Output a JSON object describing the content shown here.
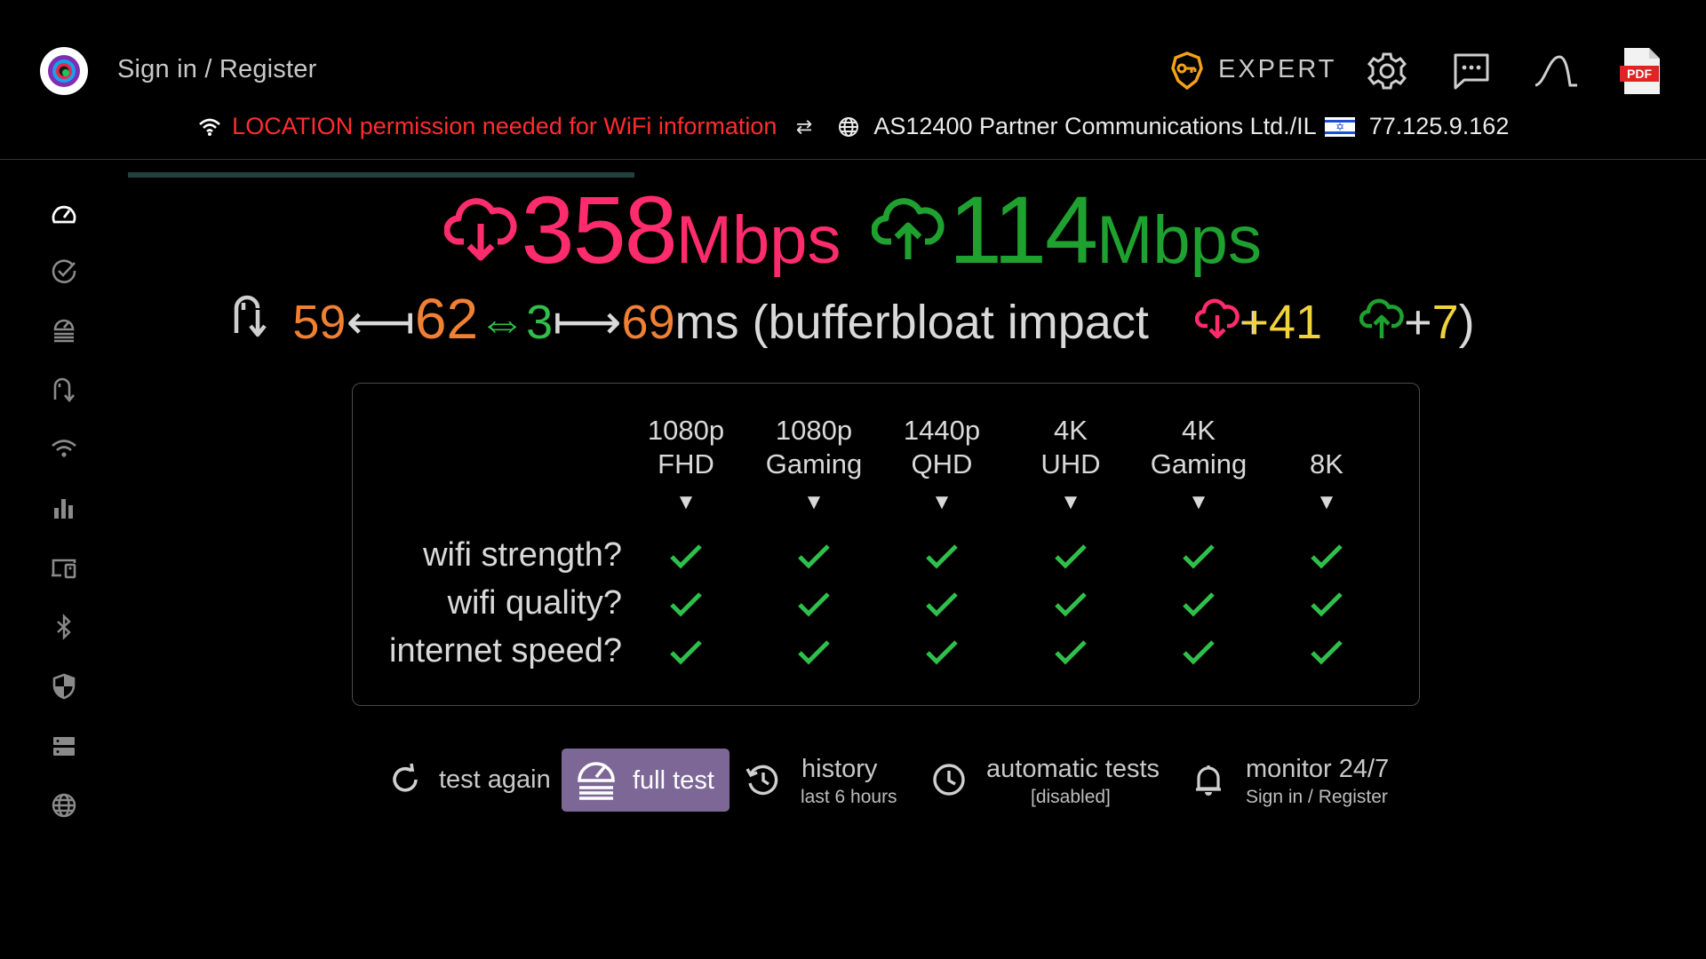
{
  "header": {
    "signin_label": "Sign in / Register",
    "expert_label": "EXPERT",
    "icons": [
      "logo-icon",
      "expert-key-icon",
      "settings-icon",
      "chat-icon",
      "graph-icon",
      "pdf-icon"
    ],
    "pdf_text": "PDF"
  },
  "infobar": {
    "location_warning": "LOCATION permission needed for WiFi information",
    "arrows": "⇄",
    "isp": "AS12400 Partner Communications Ltd./IL",
    "ip": "77.125.9.162"
  },
  "test_progress": 0.3,
  "sidebar": {
    "items": [
      "speedometer-icon",
      "check-circle-icon",
      "speedtest-list-icon",
      "latency-icon",
      "wifi-icon",
      "bar-chart-icon",
      "devices-icon",
      "bluetooth-icon",
      "shield-icon",
      "server-icon",
      "globe-icon"
    ],
    "active_index": 0
  },
  "speed": {
    "download_value": "358",
    "download_unit": "Mbps",
    "upload_value": "114",
    "upload_unit": "Mbps"
  },
  "latency": {
    "idle": "59",
    "arrow_left": "⟻",
    "loaded": "62",
    "double_arrow": "⇔",
    "jitter": "3",
    "arrow_right": "⟼",
    "max": "69",
    "suffix": "ms (bufferbloat impact",
    "dl_impact": "+41",
    "ul_plus": "+",
    "ul_impact": "7",
    "close": ")"
  },
  "quality_table": {
    "columns": [
      {
        "line1": "1080p",
        "line2": "FHD"
      },
      {
        "line1": "1080p",
        "line2": "Gaming"
      },
      {
        "line1": "1440p",
        "line2": "QHD"
      },
      {
        "line1": "4K",
        "line2": "UHD"
      },
      {
        "line1": "4K",
        "line2": "Gaming"
      },
      {
        "line1": "",
        "line2": "8K"
      }
    ],
    "arrow": "▼",
    "rows": [
      "wifi strength?",
      "wifi quality?",
      "internet speed?"
    ],
    "status": [
      [
        true,
        true,
        true,
        true,
        true,
        true
      ],
      [
        true,
        true,
        true,
        true,
        true,
        true
      ],
      [
        true,
        true,
        true,
        true,
        true,
        true
      ]
    ],
    "check_color": "#2fbf4a"
  },
  "toolbar": {
    "test_again": "test again",
    "full_test": "full test",
    "history": "history",
    "history_sub": "last 6 hours",
    "auto_tests": "automatic tests",
    "auto_tests_sub": "[disabled]",
    "monitor": "monitor 24/7",
    "monitor_sub": "Sign in / Register"
  },
  "colors": {
    "download": "#ff2c6d",
    "upload": "#1fa12f",
    "warning": "#ff2d2d",
    "latency": "#f08033",
    "impact": "#f0d23a",
    "accent_button": "#7c6797"
  }
}
